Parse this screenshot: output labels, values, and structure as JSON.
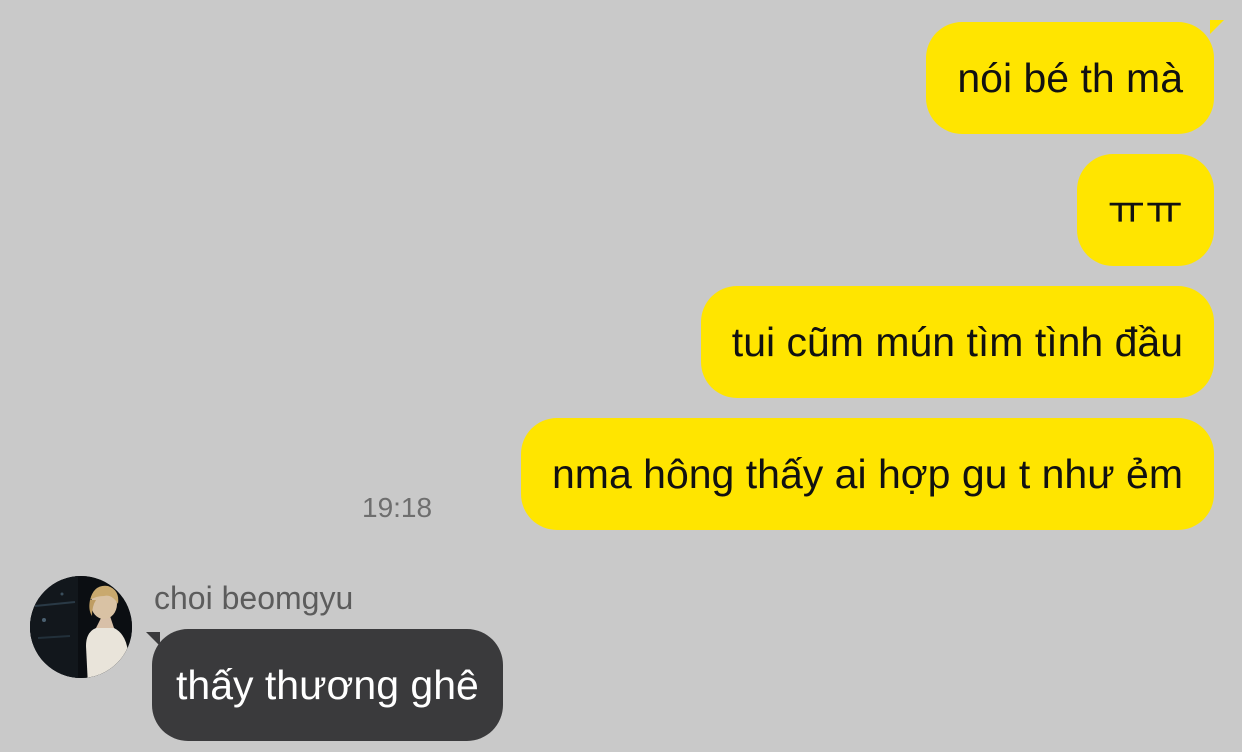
{
  "colors": {
    "background": "#c9c9c9",
    "sent_bubble": "#ffe500",
    "received_bubble": "#3a3a3c"
  },
  "messages_sent": [
    {
      "text": "nói bé th mà"
    },
    {
      "text": "ㅠㅠ"
    },
    {
      "text": "tui cũm mún tìm tình đầu"
    },
    {
      "text": "nma hông thấy ai hợp gu t như ẻm"
    }
  ],
  "sent_timestamp": "19:18",
  "received": {
    "sender_name": "choi beomgyu",
    "avatar_icon": "profile-photo",
    "messages": [
      {
        "text": "thấy thương ghê"
      }
    ]
  }
}
